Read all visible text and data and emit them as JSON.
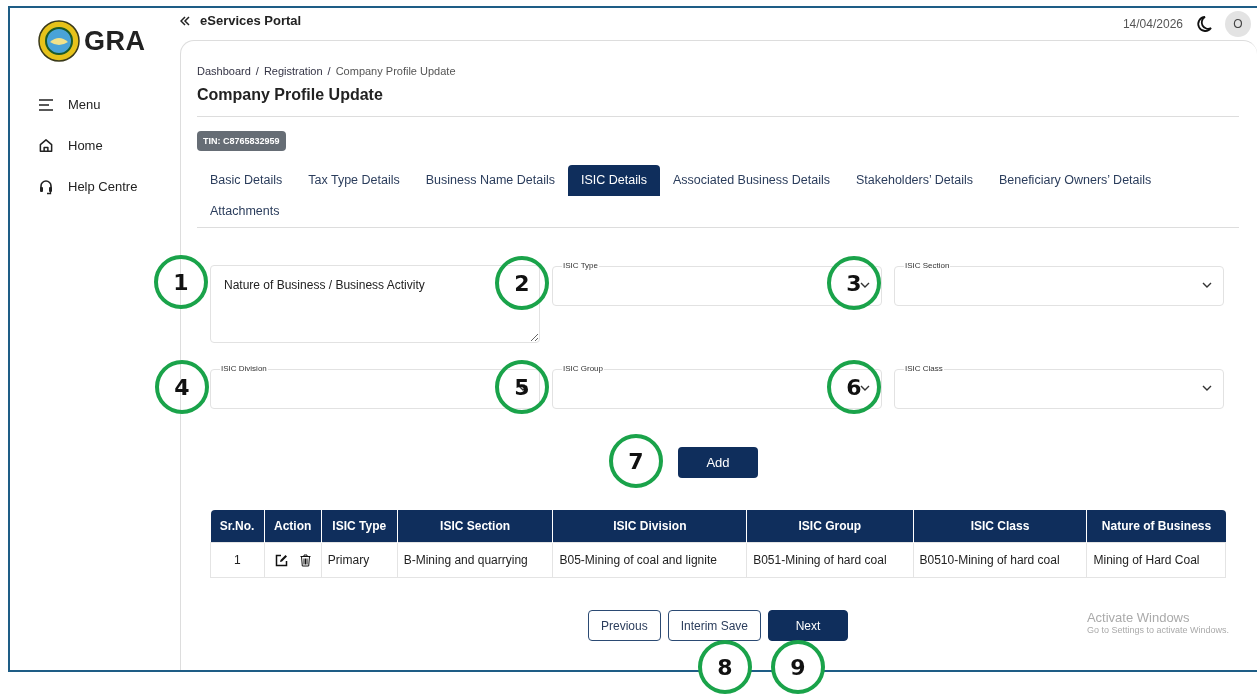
{
  "logo": {
    "text": "GRA"
  },
  "sidebar": {
    "items": [
      {
        "kind": "menu",
        "label": "Menu"
      },
      {
        "kind": "home",
        "label": "Home"
      },
      {
        "kind": "help",
        "label": "Help Centre"
      }
    ]
  },
  "topbar": {
    "title": "eServices Portal",
    "date": "14/04/2026",
    "avatar": "O"
  },
  "breadcrumb": [
    {
      "kind": "link",
      "text": "Dashboard"
    },
    {
      "kind": "separator",
      "text": "/"
    },
    {
      "kind": "link",
      "text": "Registration"
    },
    {
      "kind": "separator",
      "text": "/"
    },
    {
      "kind": "current",
      "text": "Company Profile Update"
    }
  ],
  "page_title": "Company Profile Update",
  "tin_badge": "TIN: C8765832959",
  "tabs": [
    {
      "label": "Basic Details",
      "selected": false
    },
    {
      "label": "Tax Type Details",
      "selected": false
    },
    {
      "label": "Business Name Details",
      "selected": false
    },
    {
      "label": "ISIC Details",
      "selected": true
    },
    {
      "label": "Associated Business Details",
      "selected": false
    },
    {
      "label": "Stakeholders’ Details",
      "selected": false
    },
    {
      "label": "Beneficiary Owners’ Details",
      "selected": false
    },
    {
      "label": "Attachments",
      "selected": false
    }
  ],
  "form": {
    "fields": [
      {
        "kind": "textarea",
        "placeholder": "Nature of Business / Business Activity"
      },
      {
        "kind": "select",
        "label": "ISIC Type"
      },
      {
        "kind": "select",
        "label": "ISIC Section"
      },
      {
        "kind": "select",
        "label": "ISIC Division"
      },
      {
        "kind": "select",
        "label": "ISIC Group"
      },
      {
        "kind": "select",
        "label": "ISIC Class"
      }
    ],
    "add_button": "Add"
  },
  "table": {
    "columns": [
      "Sr.No.",
      "Action",
      "ISIC Type",
      "ISIC Section",
      "ISIC Division",
      "ISIC Group",
      "ISIC Class",
      "Nature of Business"
    ],
    "rows": [
      [
        "1",
        null,
        "Primary",
        "B-Mining and quarrying",
        "B05-Mining of coal and lignite",
        "B051-Mining of hard coal",
        "B0510-Mining of hard coal",
        "Mining of Hard Coal"
      ]
    ]
  },
  "footer_buttons": [
    {
      "kind": "outline",
      "label": "Previous"
    },
    {
      "kind": "outline",
      "label": "Interim Save"
    },
    {
      "kind": "primary",
      "label": "Next"
    }
  ],
  "os_notice": {
    "title": "Activate Windows",
    "subtitle": "Go to Settings to activate Windows."
  },
  "annotations": [
    "1",
    "2",
    "3",
    "4",
    "5",
    "6",
    "7",
    "8",
    "9"
  ]
}
